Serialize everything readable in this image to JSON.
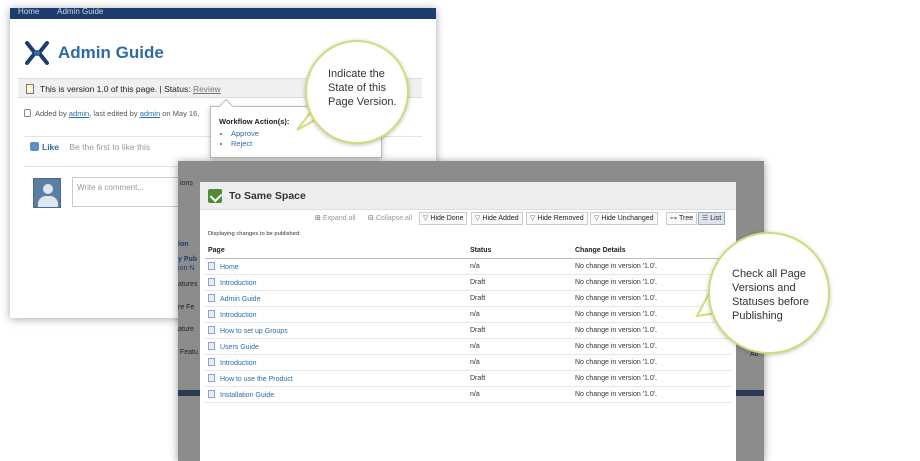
{
  "admin_page": {
    "topnav": [
      "Home",
      "Admin Guide"
    ],
    "title": "Admin Guide",
    "version_text": "This is version 1.0 of this page. | Status:",
    "status_link": "Review",
    "meta_prefix": "Added by",
    "added_by": "admin",
    "meta_mid": ", last edited by",
    "edited_by": "admin",
    "meta_suffix": "on May 16,",
    "like_label": "Like",
    "like_hint": "Be the first to like this",
    "comment_placeholder": "Write a comment..."
  },
  "workflow_popup": {
    "title": "Workflow Action(s):",
    "actions": [
      "Approve",
      "Reject"
    ]
  },
  "background_fragments": [
    "ions",
    "ion",
    "y Pub",
    "ion N",
    "atures",
    "re Fe",
    "ature",
    "Featu",
    "Ab"
  ],
  "dialog": {
    "title": "To Same Space",
    "toolbar": {
      "expand_all": "Expand all",
      "collapse_all": "Collapse all",
      "hide_done": "Hide Done",
      "hide_added": "Hide Added",
      "hide_removed": "Hide Removed",
      "hide_unchanged": "Hide Unchanged",
      "tree": "Tree",
      "list": "List"
    },
    "displaying_text": "Displaying changes to be published:",
    "columns": [
      "Page",
      "Status",
      "Change Details"
    ],
    "rows": [
      {
        "page": "Home",
        "status": "n/a",
        "details": "No change in version '1.0'."
      },
      {
        "page": "Introduction",
        "status": "Draft",
        "details": "No change in version '1.0'."
      },
      {
        "page": "Admin Guide",
        "status": "Draft",
        "details": "No change in version '1.0'."
      },
      {
        "page": "Introduction",
        "status": "n/a",
        "details": "No change in version '1.0'."
      },
      {
        "page": "How to set up Groups",
        "status": "Draft",
        "details": "No change in version '1.0'."
      },
      {
        "page": "Users Guide",
        "status": "n/a",
        "details": "No change in version '1.0'."
      },
      {
        "page": "Introduction",
        "status": "n/a",
        "details": "No change in version '1.0'."
      },
      {
        "page": "How to use the Product",
        "status": "Draft",
        "details": "No change in version '1.0'."
      },
      {
        "page": "Installation Guide",
        "status": "n/a",
        "details": "No change in version '1.0'."
      }
    ]
  },
  "callouts": {
    "top": [
      "Indicate the",
      "State of this",
      "Page Version."
    ],
    "right": [
      "Check all Page",
      "Versions and",
      "Statuses before",
      "Publishing"
    ]
  },
  "colors": {
    "link": "#2d6ca2",
    "navbar": "#1c3d6e",
    "callout_border": "#d4da7a"
  }
}
